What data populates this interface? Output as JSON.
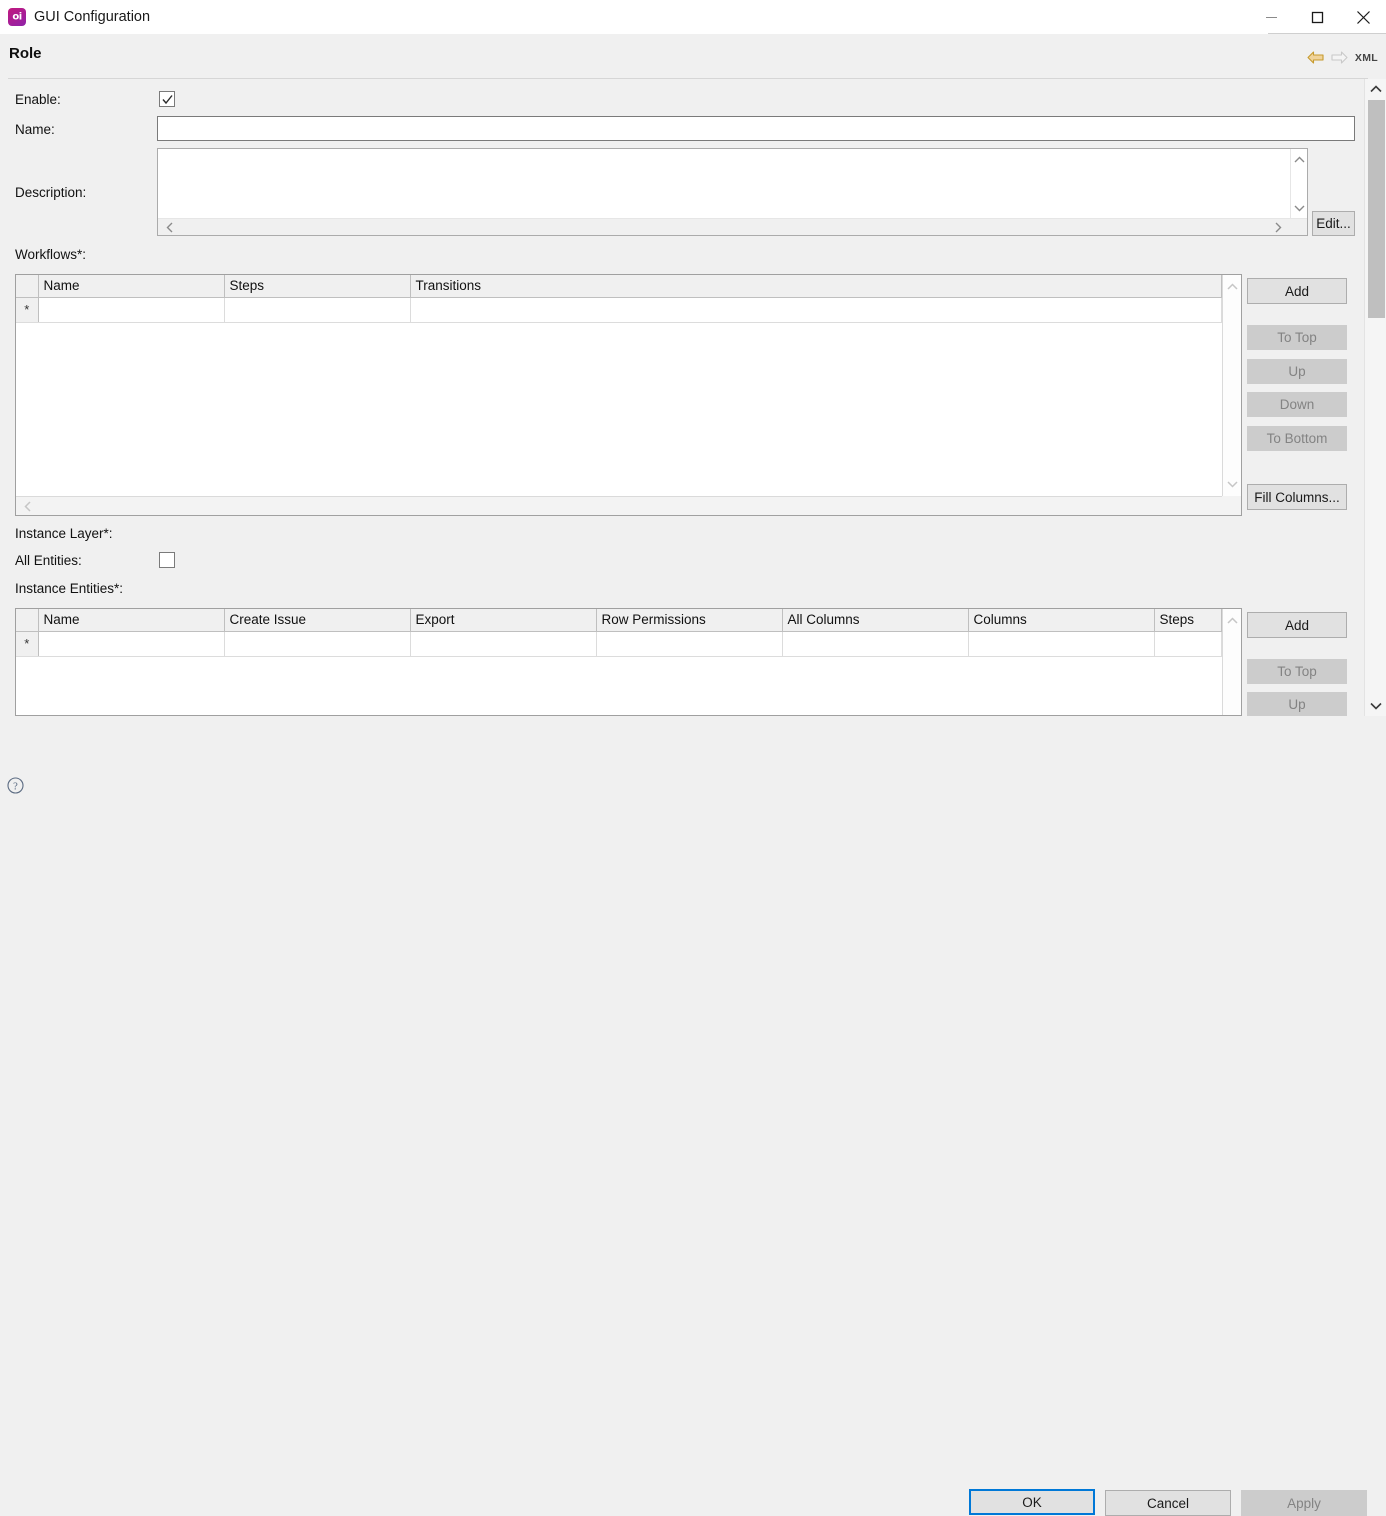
{
  "window": {
    "title": "GUI Configuration",
    "app_icon": "app-logo-icon",
    "minimize_label": "Minimize",
    "maximize_label": "Maximize",
    "close_label": "Close"
  },
  "header": {
    "title": "Role",
    "back_label": "Back",
    "forward_label": "Forward",
    "xml_label": "XML"
  },
  "form": {
    "enable_label": "Enable:",
    "enable_checked": true,
    "name_label": "Name:",
    "name_value": "",
    "name_placeholder": "",
    "description_label": "Description:",
    "description_value": "",
    "edit_button": "Edit..."
  },
  "workflows": {
    "section_label": "Workflows*:",
    "columns": [
      "Name",
      "Steps",
      "Transitions"
    ],
    "rows": [
      {
        "marker": "*",
        "cells": [
          "",
          "",
          ""
        ]
      }
    ],
    "buttons": {
      "add": "Add",
      "to_top": "To Top",
      "up": "Up",
      "down": "Down",
      "to_bottom": "To Bottom",
      "fill_columns": "Fill Columns..."
    }
  },
  "instance_layer": {
    "section_label": "Instance Layer*:",
    "all_entities_label": "All Entities:",
    "all_entities_checked": false
  },
  "instance_entities": {
    "section_label": "Instance Entities*:",
    "columns": [
      "Name",
      "Create Issue",
      "Export",
      "Row Permissions",
      "All Columns",
      "Columns",
      "Steps"
    ],
    "rows": [
      {
        "marker": "*",
        "cells": [
          "",
          "",
          "",
          "",
          "",
          "",
          ""
        ]
      }
    ],
    "buttons": {
      "add": "Add",
      "to_top": "To Top",
      "up": "Up"
    }
  },
  "footer": {
    "help_label": "Help",
    "ok": "OK",
    "cancel": "Cancel",
    "apply": "Apply"
  },
  "colors": {
    "window_bg": "#f0f0f0",
    "titlebar_bg": "#ffffff",
    "accent": "#0078d7",
    "brand": "#b3197f",
    "nav_active": "#d6a335",
    "nav_inactive": "#cfcfcf",
    "disabled_text": "#838383"
  }
}
